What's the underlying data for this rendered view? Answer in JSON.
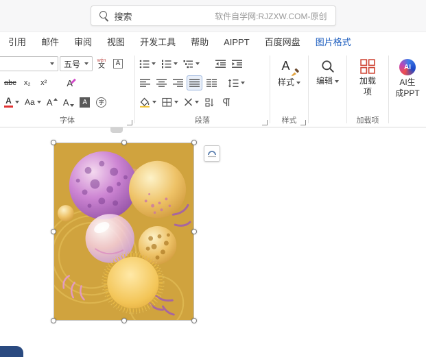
{
  "colors": {
    "accent_blue": "#185abd",
    "image_background": "#d0a33e",
    "font_color_swatch": "#e03131",
    "corner_badge": "#2a4a80"
  },
  "topbar": {
    "search_label": "搜索",
    "watermark": "软件自学网:RJZXW.COM-原创"
  },
  "tabs": [
    {
      "label": "引用"
    },
    {
      "label": "邮件"
    },
    {
      "label": "审阅"
    },
    {
      "label": "视图"
    },
    {
      "label": "开发工具"
    },
    {
      "label": "帮助"
    },
    {
      "label": "AIPPT"
    },
    {
      "label": "百度网盘"
    },
    {
      "label": "图片格式",
      "active": true
    }
  ],
  "ribbon": {
    "font": {
      "group_label": "字体",
      "font_name_value": "",
      "font_size_value": "五号",
      "phonetic_top": "wén",
      "phonetic_bottom": "文",
      "char_border_glyph": "A",
      "strikethrough_glyph": "abc",
      "subscript_glyph": "x₂",
      "superscript_glyph": "x²",
      "clear_format_glyph": "A",
      "font_color_glyph": "A",
      "change_case_glyph": "Aa",
      "grow_font_glyph": "A",
      "shrink_font_glyph": "A",
      "char_shading_glyph": "A",
      "enclose_char_glyph": "字"
    },
    "paragraph": {
      "group_label": "段落"
    },
    "styles": {
      "group_label": "样式",
      "button_label": "样式",
      "icon_glyph": "A"
    },
    "editing": {
      "button_label": "编辑"
    },
    "addins": {
      "group_label": "加载项",
      "button_line1": "加载",
      "button_line2": "项"
    },
    "ai": {
      "logo_text": "AI",
      "button_line1": "AI生",
      "button_line2": "成PPT"
    }
  }
}
